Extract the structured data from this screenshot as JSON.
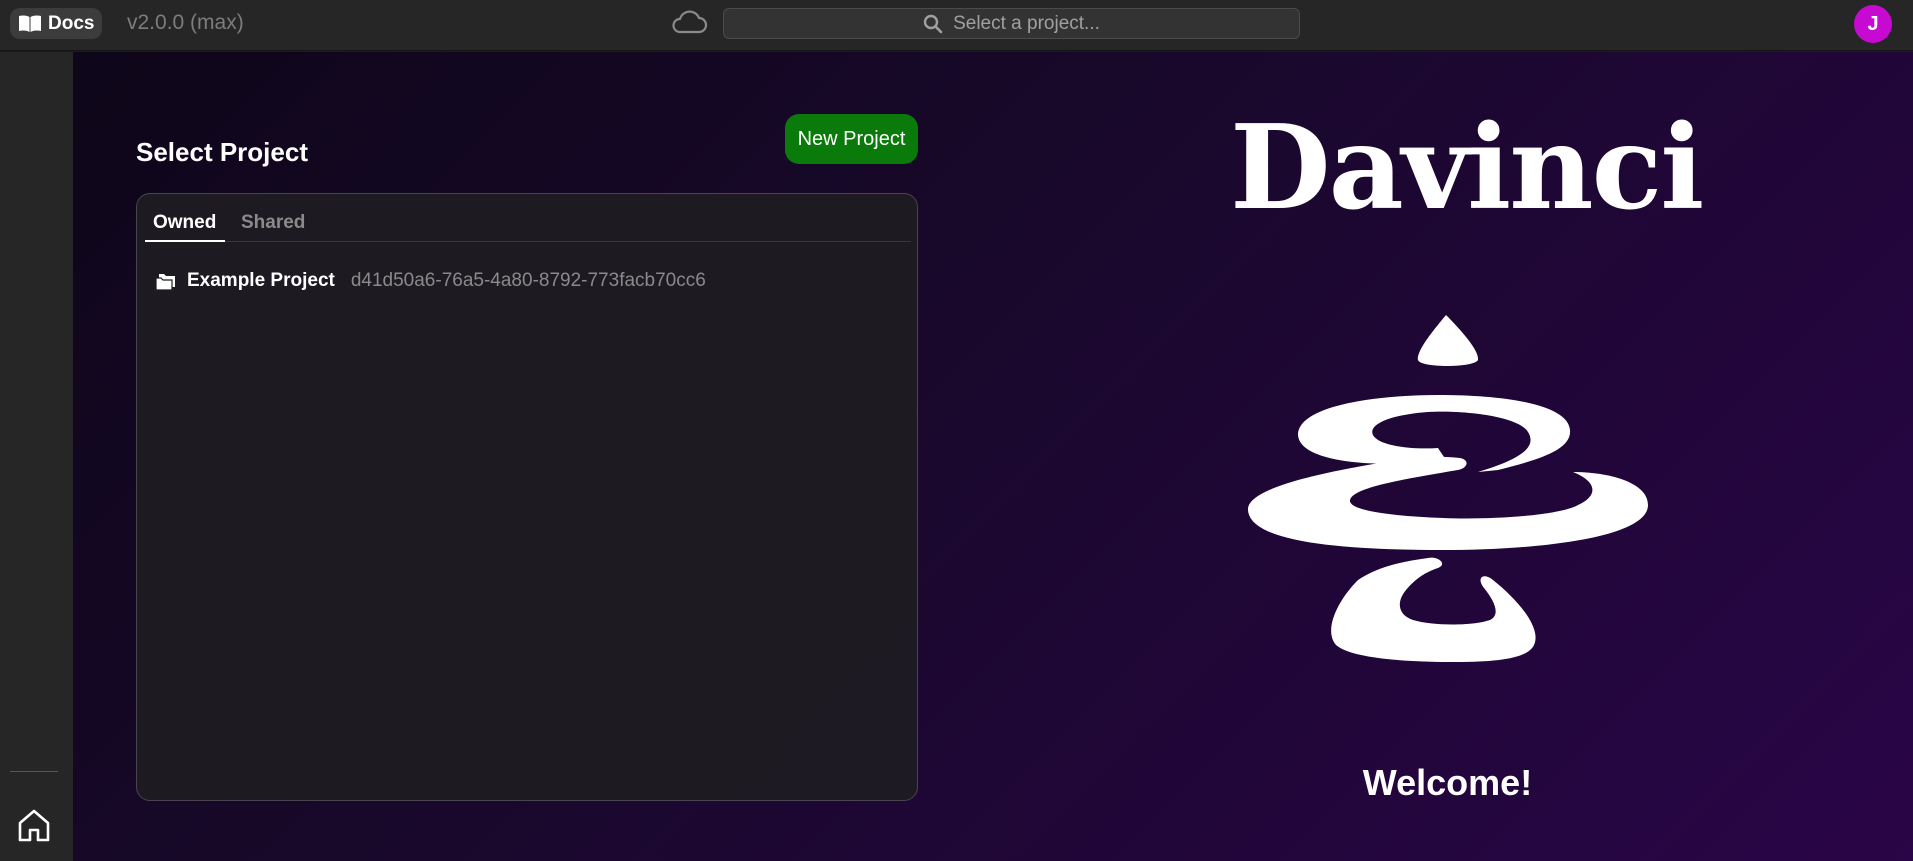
{
  "topbar": {
    "docs_label": "Docs",
    "version": "v2.0.0 (max)",
    "search_placeholder": "Select a project...",
    "avatar_initial": "J"
  },
  "main": {
    "select_title": "Select Project",
    "new_project_label": "New Project",
    "tabs": [
      {
        "label": "Owned",
        "active": true
      },
      {
        "label": "Shared",
        "active": false
      }
    ],
    "projects": [
      {
        "name": "Example Project",
        "id": "d41d50a6-76a5-4a80-8792-773facb70cc6"
      }
    ]
  },
  "brand": {
    "title": "Davinci",
    "welcome": "Welcome!"
  },
  "colors": {
    "accent_green": "#0a7a0a",
    "avatar": "#c70ad1",
    "background_purple": "#2a0547"
  },
  "icons": [
    "book-icon",
    "cloud-icon",
    "search-icon",
    "folder-icon",
    "home-icon",
    "davinci-logo"
  ]
}
